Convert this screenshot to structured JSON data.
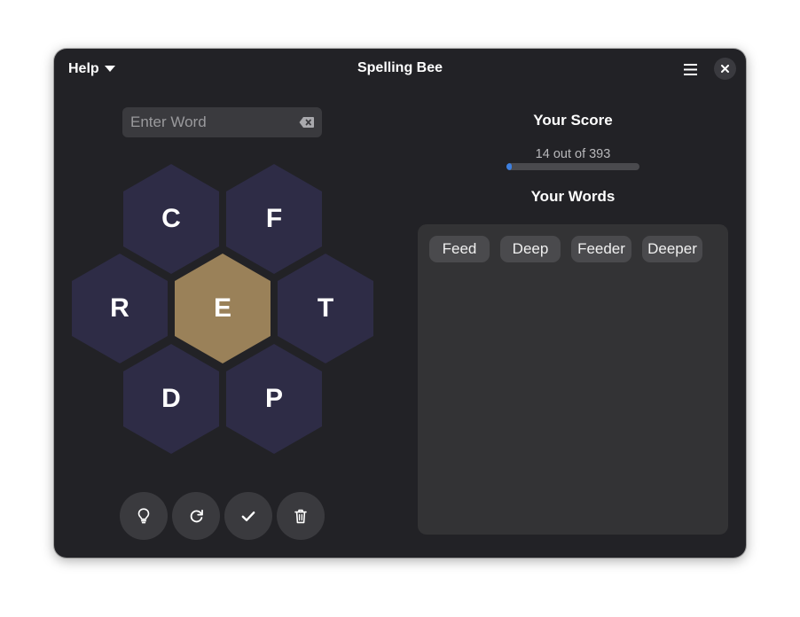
{
  "window": {
    "title": "Spelling Bee",
    "help_label": "Help"
  },
  "entry": {
    "placeholder": "Enter Word",
    "value": ""
  },
  "hive": {
    "center_letter": "E",
    "letters": [
      "C",
      "F",
      "R",
      "T",
      "D",
      "P"
    ],
    "colors": {
      "outer": "#2e2c46",
      "center": "#9a8159"
    }
  },
  "actions": [
    {
      "name": "hint-button",
      "icon": "lightbulb-icon"
    },
    {
      "name": "shuffle-button",
      "icon": "refresh-icon"
    },
    {
      "name": "submit-button",
      "icon": "check-icon"
    },
    {
      "name": "delete-button",
      "icon": "trash-icon"
    }
  ],
  "score": {
    "title": "Your Score",
    "text": "14 out of 393",
    "value": 14,
    "max": 393,
    "accent": "#3c7fe0"
  },
  "words": {
    "title": "Your Words",
    "items": [
      "Feed",
      "Deep",
      "Feeder",
      "Deeper"
    ]
  }
}
